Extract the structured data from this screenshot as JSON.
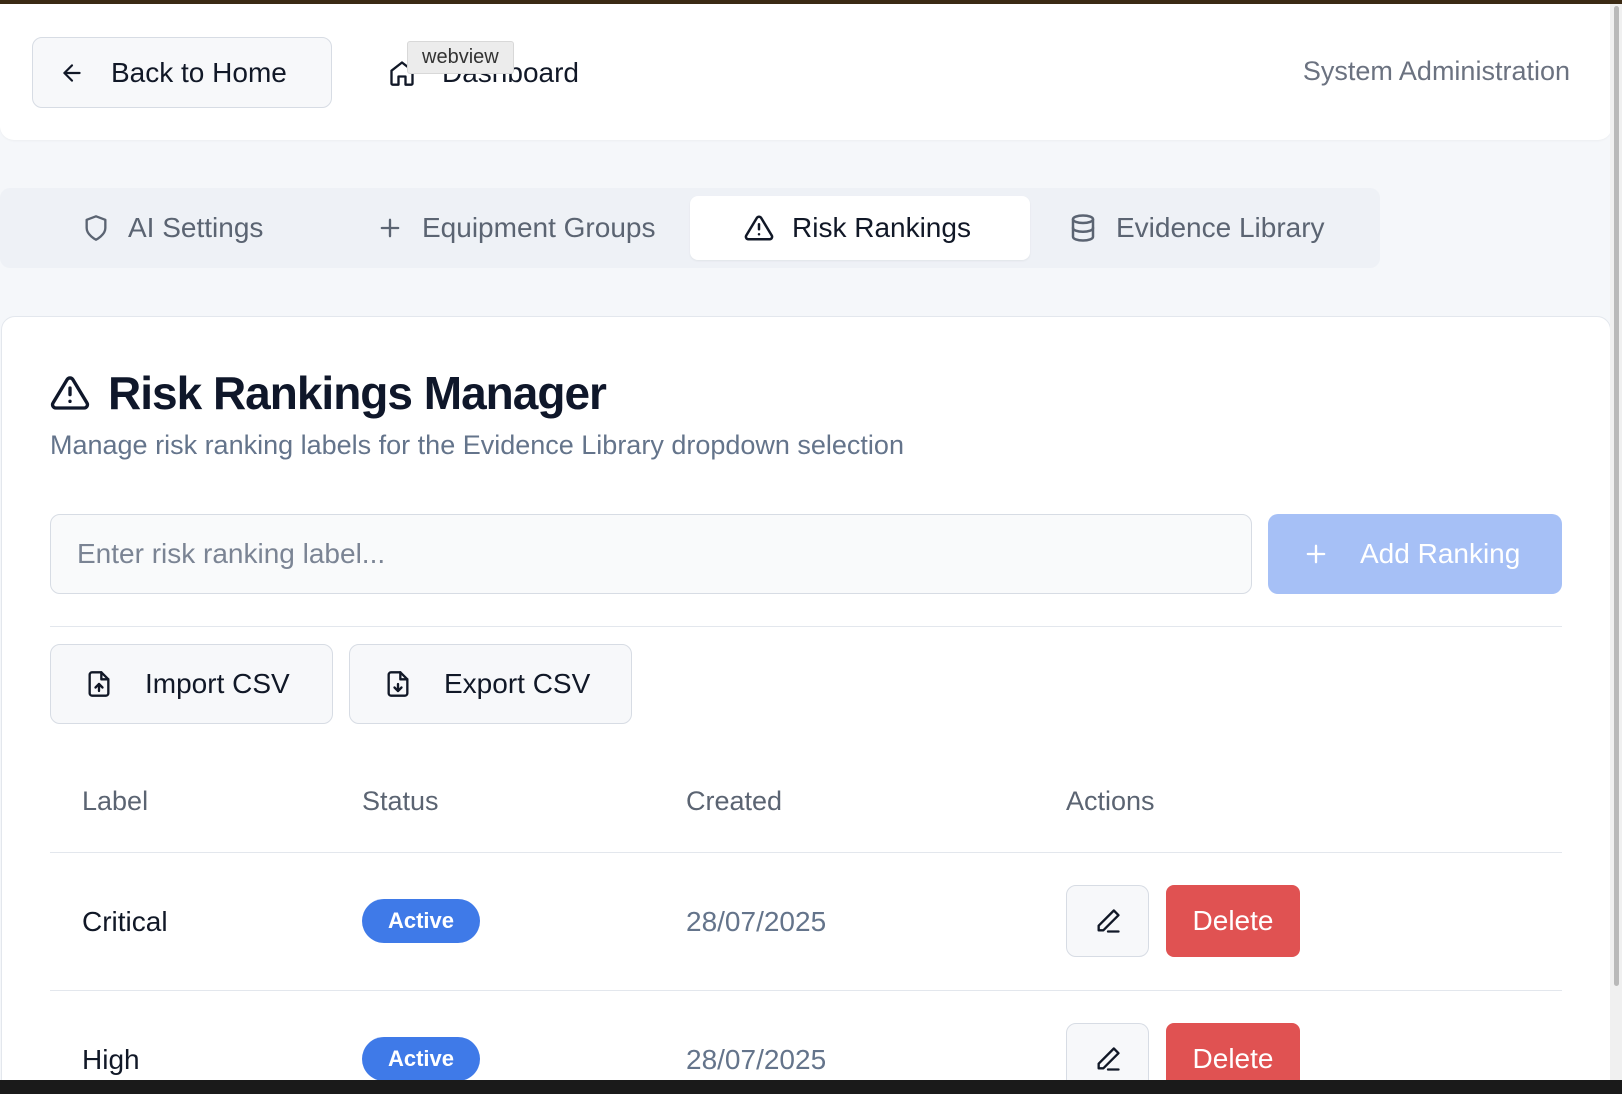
{
  "header": {
    "back_label": "Back to Home",
    "dashboard_label": "Dashboard",
    "tooltip": "webview",
    "right_label": "System Administration"
  },
  "tabs": [
    {
      "label": "AI Settings",
      "icon": "shield-icon"
    },
    {
      "label": "Equipment Groups",
      "icon": "plus-icon"
    },
    {
      "label": "Risk Rankings",
      "icon": "warning-icon",
      "active": true
    },
    {
      "label": "Evidence Library",
      "icon": "database-icon"
    }
  ],
  "main": {
    "title": "Risk Rankings Manager",
    "subtitle": "Manage risk ranking labels for the Evidence Library dropdown selection",
    "input_placeholder": "Enter risk ranking label...",
    "add_label": "Add Ranking",
    "import_label": "Import CSV",
    "export_label": "Export CSV"
  },
  "table": {
    "columns": [
      "Label",
      "Status",
      "Created",
      "Actions"
    ],
    "rows": [
      {
        "label": "Critical",
        "status": "Active",
        "created": "28/07/2025",
        "delete": "Delete"
      },
      {
        "label": "High",
        "status": "Active",
        "created": "28/07/2025",
        "delete": "Delete"
      }
    ]
  },
  "colors": {
    "accent": "#3f7ae8",
    "add_disabled": "#a6c0f6",
    "danger": "#e05252",
    "muted_text": "#64748b"
  }
}
